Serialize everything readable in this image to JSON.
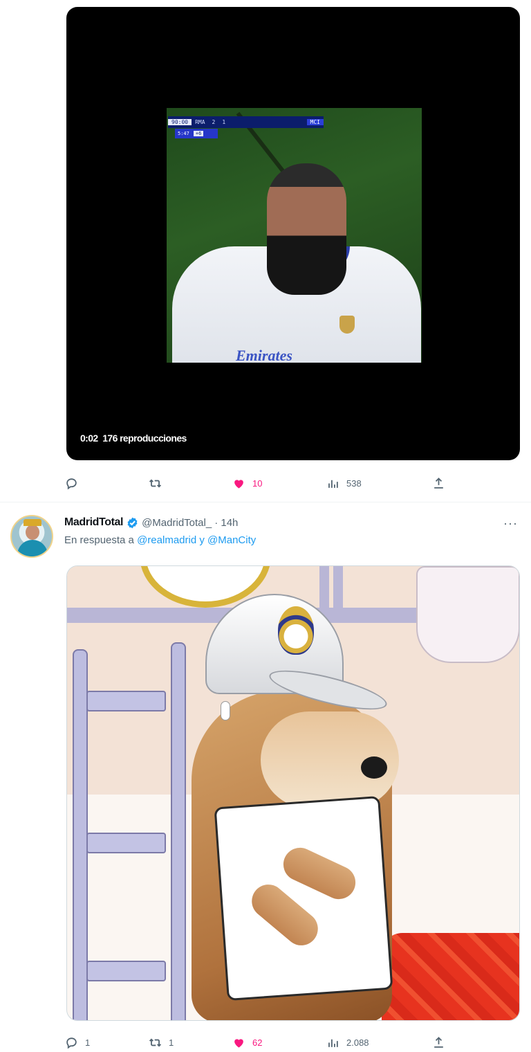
{
  "tweet1": {
    "video": {
      "duration": "0:02",
      "views": "176 reproducciones",
      "scorebug": {
        "clock": "90:00",
        "home": "RMA",
        "score_home": "2",
        "score_away": "1",
        "away": "MCI",
        "added_time": "5:47",
        "added": "+6"
      },
      "sponsor_text": "Emirates"
    },
    "actions": {
      "replies": "",
      "retweets": "",
      "likes": "10",
      "views": "538"
    }
  },
  "tweet2": {
    "author": {
      "name": "MadridTotal",
      "handle": "@MadridTotal_",
      "time": "· 14h",
      "verified": true
    },
    "reply_to": {
      "prefix": "En respuesta a ",
      "mention1": "@realmadrid",
      "joiner": " y ",
      "mention2": "@ManCity"
    },
    "more_label": "···",
    "actions": {
      "replies": "1",
      "retweets": "1",
      "likes": "62",
      "views": "2.088"
    }
  },
  "colors": {
    "like_pink": "#f91880",
    "secondary_text": "#536471",
    "link_blue": "#1d9bf0",
    "verified_blue": "#1d9bf0"
  },
  "icons": {
    "reply": "reply-icon",
    "retweet": "retweet-icon",
    "like": "heart-icon",
    "views": "views-icon",
    "share": "share-icon",
    "verified": "verified-badge-icon",
    "more": "more-icon"
  }
}
